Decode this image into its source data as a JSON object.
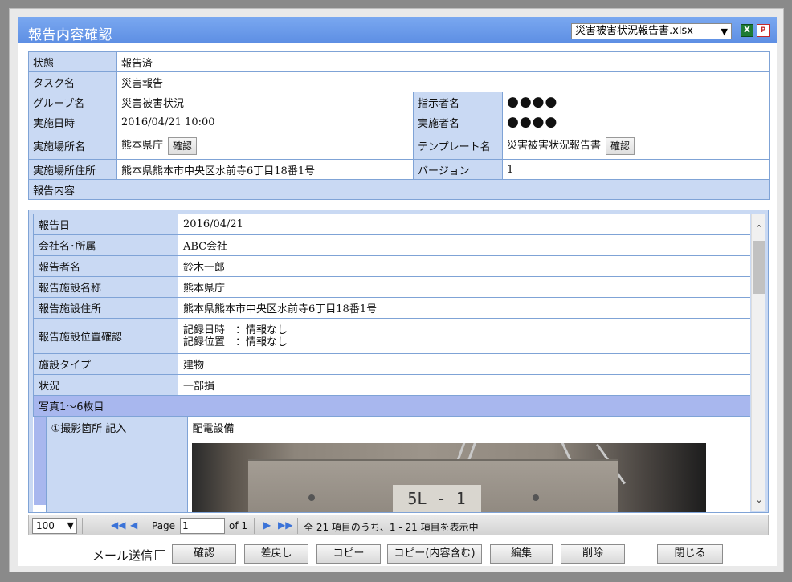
{
  "dialog": {
    "title": "報告内容確認",
    "file_select": "災害被害状況報告書.xlsx",
    "icons": {
      "excel": "excel-icon",
      "pdf": "pdf-icon"
    }
  },
  "info": {
    "status_label": "状態",
    "status_value": "報告済",
    "task_label": "タスク名",
    "task_value": "災害報告",
    "group_label": "グループ名",
    "group_value": "災害被害状況",
    "instructor_label": "指示者名",
    "instructor_value": "●●●●",
    "date_label": "実施日時",
    "date_value": "2016/04/21 10:00",
    "executor_label": "実施者名",
    "executor_value": "●●●●",
    "place_label": "実施場所名",
    "place_value": "熊本県庁",
    "place_btn": "確認",
    "template_label": "テンプレート名",
    "template_value": "災害被害状況報告書",
    "template_btn": "確認",
    "address_label": "実施場所住所",
    "address_value": "熊本県熊本市中央区水前寺6丁目18番1号",
    "version_label": "バージョン",
    "version_value": "1",
    "section_label": "報告内容"
  },
  "report": {
    "rows": [
      {
        "label": "報告日",
        "value": "2016/04/21"
      },
      {
        "label": "会社名･所属",
        "value": "ABC会社"
      },
      {
        "label": "報告者名",
        "value": "鈴木一郎"
      },
      {
        "label": "報告施設名称",
        "value": "熊本県庁"
      },
      {
        "label": "報告施設住所",
        "value": "熊本県熊本市中央区水前寺6丁目18番1号"
      }
    ],
    "location_label": "報告施設位置確認",
    "location_line1": "記録日時　：情報なし",
    "location_line2": "記録位置　：情報なし",
    "facility_type_label": "施設タイプ",
    "facility_type_value": "建物",
    "condition_label": "状況",
    "condition_value": "一部損",
    "photo_section": "写真1～6枚目",
    "photo_spot_label": "①撮影箇所  記入",
    "photo_spot_value": "配電設備",
    "photo_plate": "5L - 1"
  },
  "pager": {
    "page_size": "100",
    "page_label": "Page",
    "page_value": "1",
    "of_label": "of 1",
    "summary": "全 21 項目のうち、1 - 21 項目を表示中"
  },
  "footer": {
    "mail_label": "メール送信",
    "buttons": [
      "確認",
      "差戻し",
      "コピー",
      "コピー(内容含む)",
      "編集",
      "削除",
      "閉じる"
    ]
  }
}
